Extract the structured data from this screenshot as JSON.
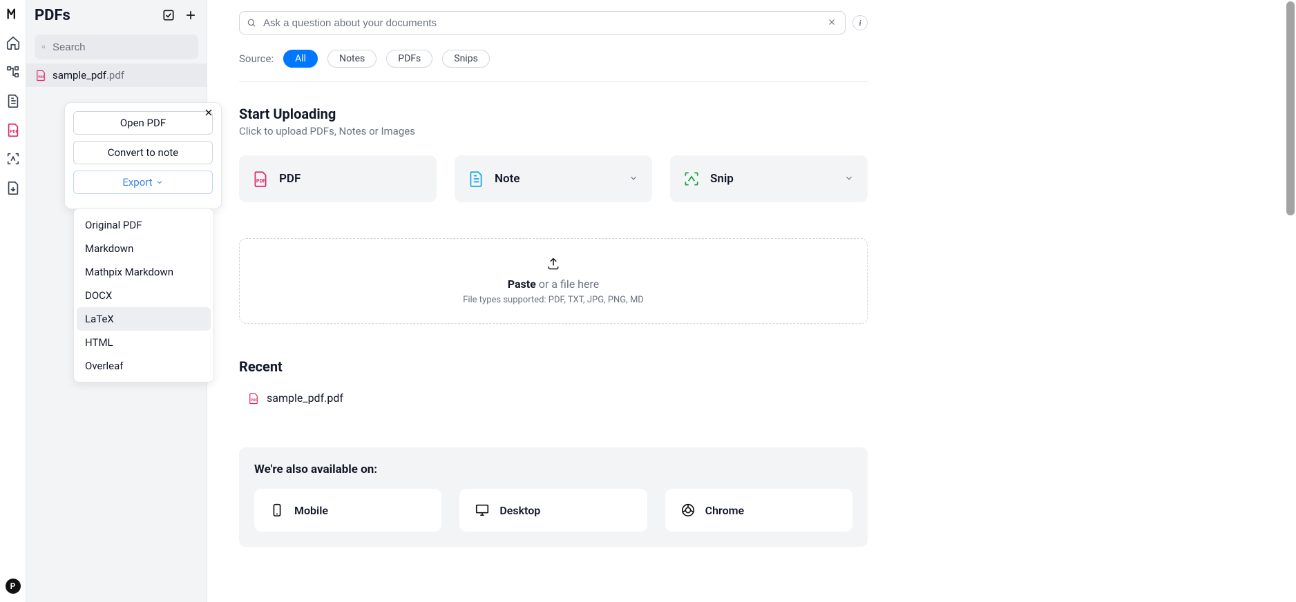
{
  "rail": {
    "avatar_letter": "P"
  },
  "sidebar": {
    "title": "PDFs",
    "search_placeholder": "Search",
    "file": {
      "name": "sample_pdf",
      "ext": ".pdf"
    }
  },
  "popover": {
    "open_label": "Open PDF",
    "convert_label": "Convert to note",
    "export_label": "Export",
    "options": [
      "Original PDF",
      "Markdown",
      "Mathpix Markdown",
      "DOCX",
      "LaTeX",
      "HTML",
      "Overleaf"
    ],
    "highlight_index": 4
  },
  "ask": {
    "placeholder": "Ask a question about your documents"
  },
  "source": {
    "label": "Source:",
    "pills": [
      "All",
      "Notes",
      "PDFs",
      "Snips"
    ],
    "selected_index": 0
  },
  "upload": {
    "heading": "Start Uploading",
    "sub": "Click to upload PDFs, Notes or Images",
    "cards": [
      {
        "label": "PDF",
        "icon": "pdf",
        "has_chevron": false
      },
      {
        "label": "Note",
        "icon": "note",
        "has_chevron": true
      },
      {
        "label": "Snip",
        "icon": "snip",
        "has_chevron": true
      }
    ]
  },
  "dropzone": {
    "strong": "Paste",
    "rest": " or a file here",
    "hint": "File types supported: PDF, TXT, JPG, PNG, MD"
  },
  "recent": {
    "heading": "Recent",
    "items": [
      "sample_pdf.pdf"
    ]
  },
  "also": {
    "heading": "We're also available on:",
    "cards": [
      {
        "label": "Mobile",
        "icon": "mobile"
      },
      {
        "label": "Desktop",
        "icon": "desktop"
      },
      {
        "label": "Chrome",
        "icon": "chrome"
      }
    ]
  }
}
